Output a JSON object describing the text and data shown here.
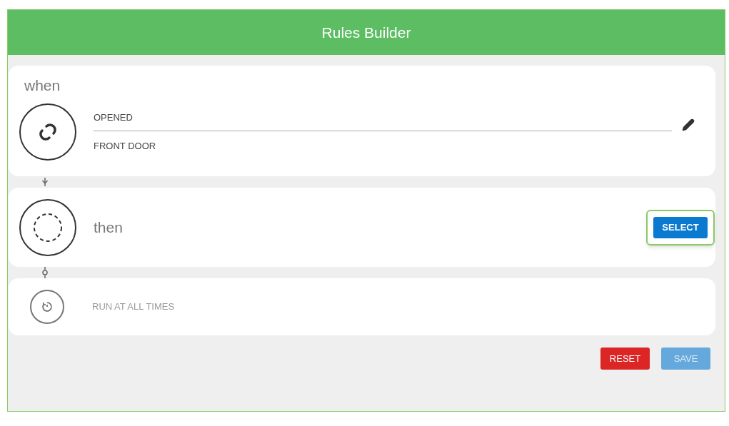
{
  "header": {
    "title": "Rules Builder"
  },
  "trigger": {
    "heading": "when",
    "event": "OPENED",
    "device": "FRONT DOOR"
  },
  "action": {
    "heading": "then",
    "button": {
      "label": "SELECT",
      "highlighted": true
    }
  },
  "condition": {
    "label": "RUN AT ALL TIMES"
  },
  "buttons": [
    {
      "kind": "reset",
      "label": "RESET",
      "disabled": false
    },
    {
      "kind": "save",
      "label": "SAVE",
      "disabled": true
    }
  ]
}
